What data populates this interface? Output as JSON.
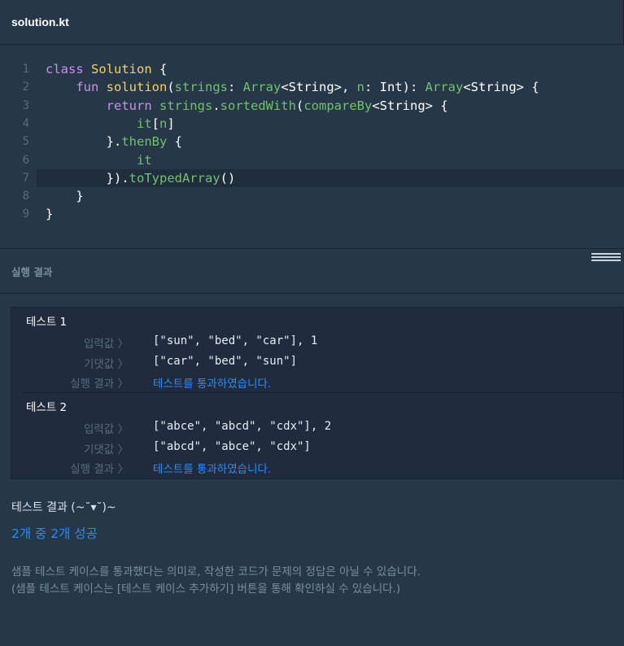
{
  "tab": {
    "filename": "solution.kt"
  },
  "editor": {
    "line_numbers": [
      "1",
      "2",
      "3",
      "4",
      "5",
      "6",
      "7",
      "8",
      "9"
    ],
    "lines": [
      [
        {
          "t": "class ",
          "c": "kw"
        },
        {
          "t": "Solution",
          "c": "cls"
        },
        {
          "t": " {",
          "c": "pl"
        }
      ],
      [
        {
          "t": "    fun ",
          "c": "kw"
        },
        {
          "t": "solution",
          "c": "fn"
        },
        {
          "t": "(",
          "c": "pl"
        },
        {
          "t": "strings",
          "c": "par"
        },
        {
          "t": ": ",
          "c": "pl"
        },
        {
          "t": "Array",
          "c": "typ"
        },
        {
          "t": "<String>, ",
          "c": "pl"
        },
        {
          "t": "n",
          "c": "par"
        },
        {
          "t": ": Int): ",
          "c": "pl"
        },
        {
          "t": "Array",
          "c": "typ"
        },
        {
          "t": "<String> {",
          "c": "pl"
        }
      ],
      [
        {
          "t": "        return ",
          "c": "kw"
        },
        {
          "t": "strings",
          "c": "grn"
        },
        {
          "t": ".",
          "c": "pl"
        },
        {
          "t": "sortedWith",
          "c": "grn"
        },
        {
          "t": "(",
          "c": "pl"
        },
        {
          "t": "compareBy",
          "c": "grn"
        },
        {
          "t": "<String> {",
          "c": "pl"
        }
      ],
      [
        {
          "t": "            ",
          "c": "pl"
        },
        {
          "t": "it",
          "c": "grn"
        },
        {
          "t": "[",
          "c": "pl"
        },
        {
          "t": "n",
          "c": "grn"
        },
        {
          "t": "]",
          "c": "pl"
        }
      ],
      [
        {
          "t": "        }.",
          "c": "pl"
        },
        {
          "t": "thenBy",
          "c": "grn"
        },
        {
          "t": " {",
          "c": "pl"
        }
      ],
      [
        {
          "t": "            ",
          "c": "pl"
        },
        {
          "t": "it",
          "c": "grn"
        }
      ],
      [
        {
          "t": "        }).",
          "c": "pl"
        },
        {
          "t": "toTypedArray",
          "c": "grn"
        },
        {
          "t": "()",
          "c": "pl"
        }
      ],
      [
        {
          "t": "    }",
          "c": "pl"
        }
      ],
      [
        {
          "t": "}",
          "c": "pl"
        }
      ]
    ]
  },
  "result": {
    "title": "실행 결과",
    "tests": [
      {
        "name": "테스트 1",
        "input_label": "입력값 〉",
        "input": "[\"sun\", \"bed\", \"car\"], 1",
        "expected_label": "기댓값 〉",
        "expected": "[\"car\", \"bed\", \"sun\"]",
        "result_label": "실행 결과 〉",
        "result": "테스트를 통과하였습니다."
      },
      {
        "name": "테스트 2",
        "input_label": "입력값 〉",
        "input": "[\"abce\", \"abcd\", \"cdx\"], 2",
        "expected_label": "기댓값 〉",
        "expected": "[\"abcd\", \"abce\", \"cdx\"]",
        "result_label": "실행 결과 〉",
        "result": "테스트를 통과하였습니다."
      }
    ],
    "summary_title": "테스트 결과 (~˘▾˘)~",
    "summary_count": "2개 중 2개 성공",
    "note1": "샘플 테스트 케이스를 통과했다는 의미로, 작성한 코드가 문제의 정답은 아닐 수 있습니다.",
    "note2": "(샘플 테스트 케이스는 [테스트 케이스 추가하기] 버튼을 통해 확인하실 수 있습니다.)"
  },
  "colors": {
    "background": "#263747",
    "panel": "#202b3d",
    "accent_blue": "#2e8bf0",
    "keyword": "#c792ea",
    "identifier": "#72c16f",
    "class_name": "#f7d15e"
  }
}
